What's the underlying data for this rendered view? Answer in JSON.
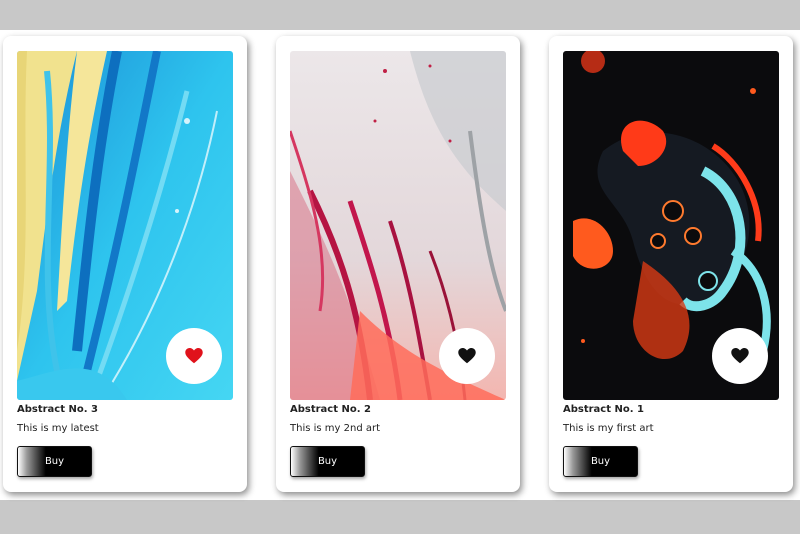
{
  "cards": [
    {
      "title": "Abstract No. 3",
      "description": "This is my latest",
      "buy_label": "Buy",
      "liked": true,
      "heart_color": "#e0121b",
      "artwork_palette": [
        "#12a7d6",
        "#3ad2f0",
        "#f2e28a",
        "#ffffff"
      ]
    },
    {
      "title": "Abstract No. 2",
      "description": "This is my 2nd art",
      "buy_label": "Buy",
      "liked": false,
      "heart_color": "#111111",
      "artwork_palette": [
        "#e8e2e4",
        "#c7154a",
        "#ff6f61",
        "#9fa3a8"
      ]
    },
    {
      "title": "Abstract No. 1",
      "description": "This is my first art",
      "buy_label": "Buy",
      "liked": false,
      "heart_color": "#111111",
      "artwork_palette": [
        "#0a0a0c",
        "#ff3b1a",
        "#7de3ea",
        "#ff8a3d"
      ]
    }
  ]
}
